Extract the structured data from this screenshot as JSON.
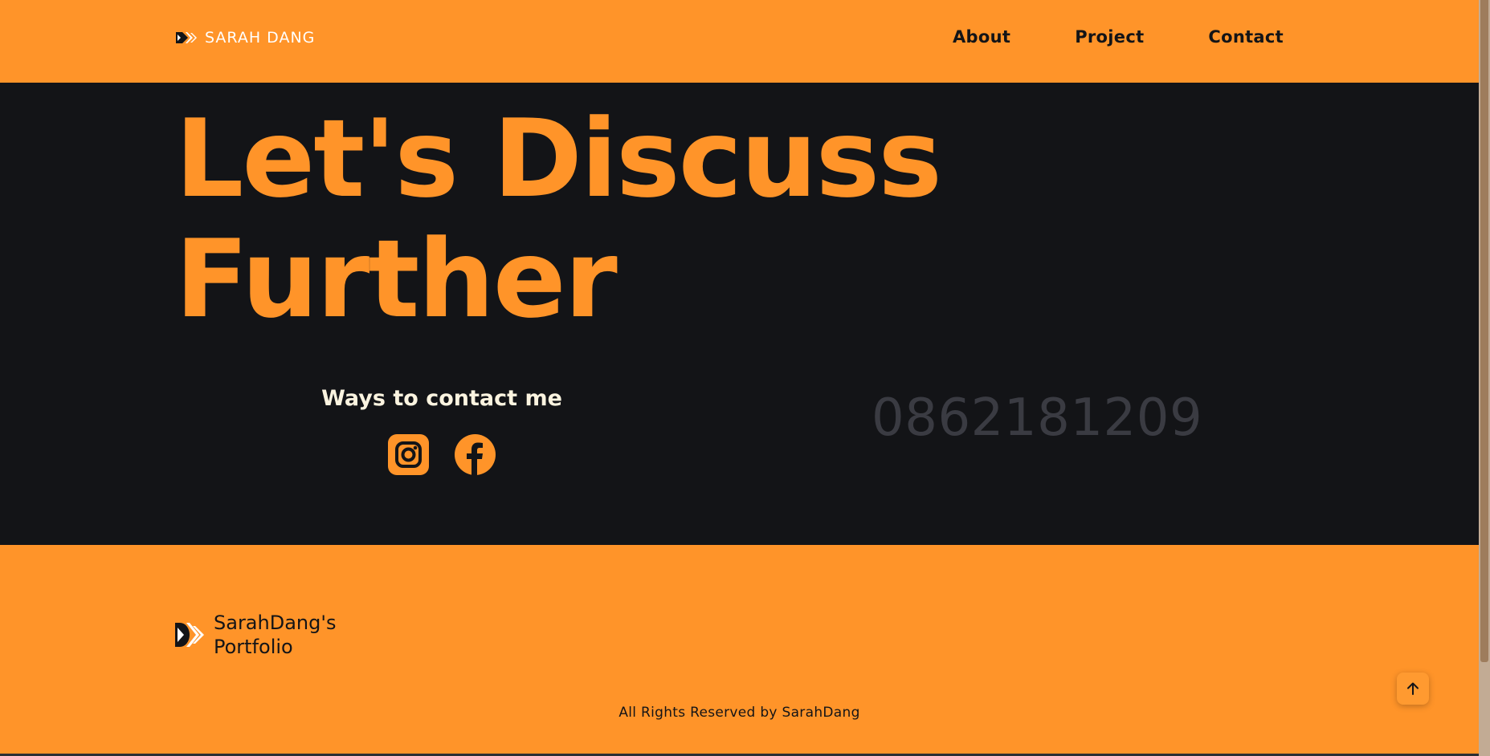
{
  "header": {
    "brand_name": "SARAH DANG",
    "brand_icon": "arrow-logo-icon",
    "nav": [
      {
        "label": "About"
      },
      {
        "label": "Project"
      },
      {
        "label": "Contact"
      }
    ]
  },
  "hero": {
    "headline_line1": "Let's Discuss",
    "headline_line2": "Further",
    "contact_title": "Ways to contact me",
    "socials": [
      {
        "name": "Instagram",
        "icon": "instagram-icon"
      },
      {
        "name": "Facebook",
        "icon": "facebook-icon"
      }
    ],
    "phone": "0862181209"
  },
  "footer": {
    "brand_line1": "SarahDang's",
    "brand_line2": "Portfolio",
    "brand_icon": "arrow-logo-icon",
    "copyright": "All Rights Reserved by SarahDang",
    "back_to_top_icon": "arrow-up-icon"
  },
  "colors": {
    "accent": "#ff9429",
    "dark": "#131417",
    "cream": "#fbf4e0",
    "phone": "#3a3b42",
    "white": "#ffffff"
  }
}
